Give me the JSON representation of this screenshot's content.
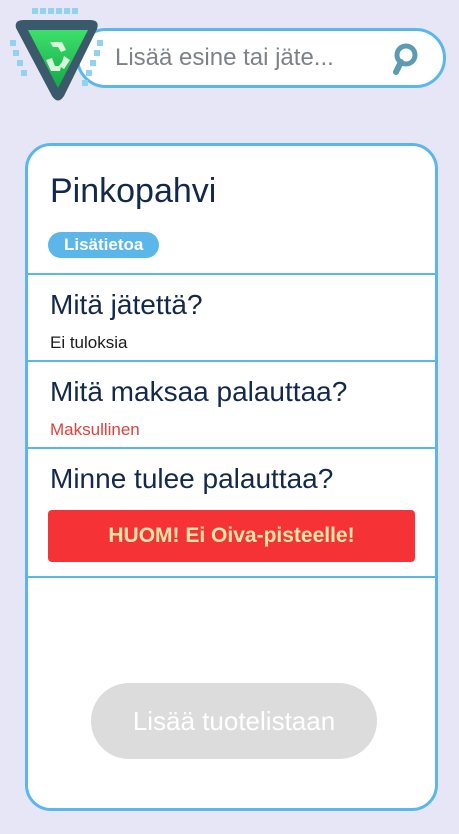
{
  "search": {
    "placeholder": "Lisää esine tai jäte..."
  },
  "product": {
    "name": "Pinkopahvi",
    "info_label": "Lisätietoa"
  },
  "questions": {
    "what": {
      "heading": "Mitä jätettä?",
      "value": "Ei tuloksia"
    },
    "cost": {
      "heading": "Mitä maksaa palauttaa?",
      "value": "Maksullinen"
    },
    "where": {
      "heading": "Minne tulee palauttaa?",
      "warning": "HUOM! Ei Oiva-pisteelle!"
    }
  },
  "actions": {
    "add_to_list": "Lisää tuotelistaan"
  },
  "colors": {
    "background": "#e7e6f6",
    "accent": "#5bb6ea",
    "heading_text": "#13294b",
    "warning_bg": "#f53236",
    "warning_text": "#ffe6a8",
    "cost_text": "#e2403b",
    "disabled_button": "#dcdcdc"
  },
  "icons": {
    "logo": "recycle-triangle-logo",
    "search": "search-icon"
  }
}
